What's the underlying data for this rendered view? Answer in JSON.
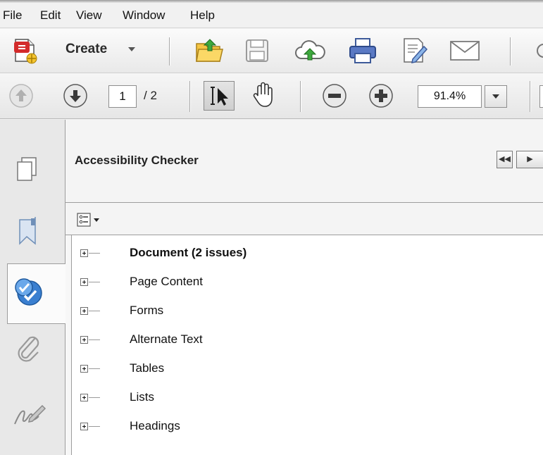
{
  "menu": {
    "items": [
      {
        "id": "file",
        "label": "File"
      },
      {
        "id": "edit",
        "label": "Edit"
      },
      {
        "id": "view",
        "label": "View"
      },
      {
        "id": "window",
        "label": "Window"
      },
      {
        "id": "help",
        "label": "Help"
      }
    ]
  },
  "toolbar": {
    "create_label": "Create",
    "icons": [
      "create-pdf-icon",
      "open-folder-icon",
      "save-icon",
      "cloud-upload-icon",
      "print-icon",
      "edit-document-icon",
      "email-icon"
    ]
  },
  "navigation": {
    "current_page": "1",
    "page_total": "/ 2",
    "zoom": "91.4%"
  },
  "leftnav": {
    "tabs": [
      "pages-icon",
      "bookmarks-icon",
      "accessibility-checker-icon",
      "attachments-icon",
      "signatures-icon"
    ],
    "active": "accessibility-checker-icon"
  },
  "panel": {
    "title": "Accessibility Checker",
    "tree_items": [
      {
        "label": "Document (2 issues)",
        "bold": true
      },
      {
        "label": "Page Content",
        "bold": false
      },
      {
        "label": "Forms",
        "bold": false
      },
      {
        "label": "Alternate Text",
        "bold": false
      },
      {
        "label": "Tables",
        "bold": false
      },
      {
        "label": "Lists",
        "bold": false
      },
      {
        "label": "Headings",
        "bold": false
      }
    ]
  }
}
